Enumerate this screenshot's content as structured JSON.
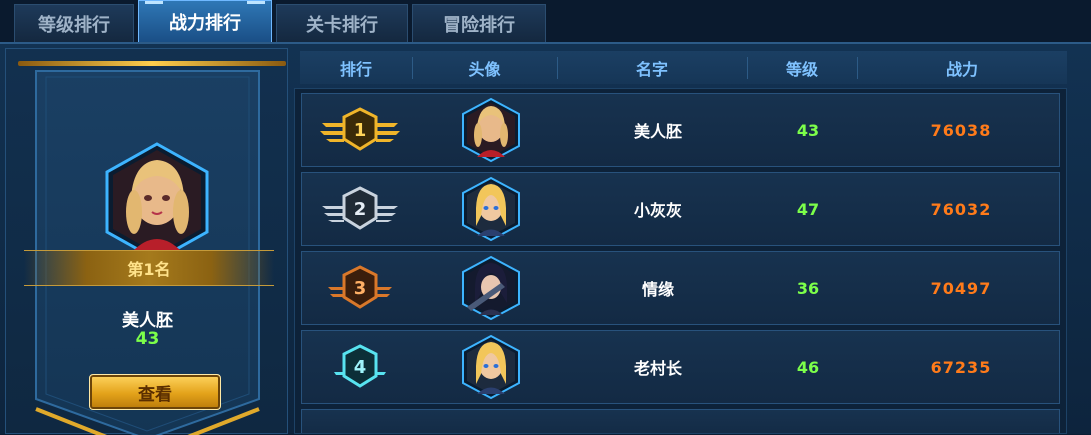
{
  "tabs": [
    {
      "label": "等级排行",
      "active": false
    },
    {
      "label": "战力排行",
      "active": true
    },
    {
      "label": "关卡排行",
      "active": false
    },
    {
      "label": "冒险排行",
      "active": false
    }
  ],
  "top_player": {
    "rank_label": "第1名",
    "name": "美人胚",
    "level": "43",
    "view_button": "查看",
    "avatar": "blonde-girl-red-dress"
  },
  "table": {
    "headers": [
      "排行",
      "头像",
      "名字",
      "等级",
      "战力"
    ],
    "rows": [
      {
        "rank": "1",
        "badge": "gold-winged-badge-icon",
        "avatar": "blonde-girl-red-dress",
        "name": "美人胚",
        "level": "43",
        "power": "76038"
      },
      {
        "rank": "2",
        "badge": "silver-winged-badge-icon",
        "avatar": "blonde-girl-blue-outfit",
        "name": "小灰灰",
        "level": "47",
        "power": "76032"
      },
      {
        "rank": "3",
        "badge": "bronze-winged-badge-icon",
        "avatar": "dark-hair-girl-armor",
        "name": "情缘",
        "level": "36",
        "power": "70497"
      },
      {
        "rank": "4",
        "badge": "cyan-winged-badge-icon",
        "avatar": "blonde-girl-blue-outfit",
        "name": "老村长",
        "level": "46",
        "power": "67235"
      }
    ]
  },
  "colors": {
    "gold": "#f0b52a",
    "silver": "#c9d3de",
    "bronze": "#d9782a",
    "cyan": "#58e3f0",
    "level_green": "#7cff4a",
    "power_orange": "#ff7b1a",
    "header_blue": "#7fc2ff"
  }
}
